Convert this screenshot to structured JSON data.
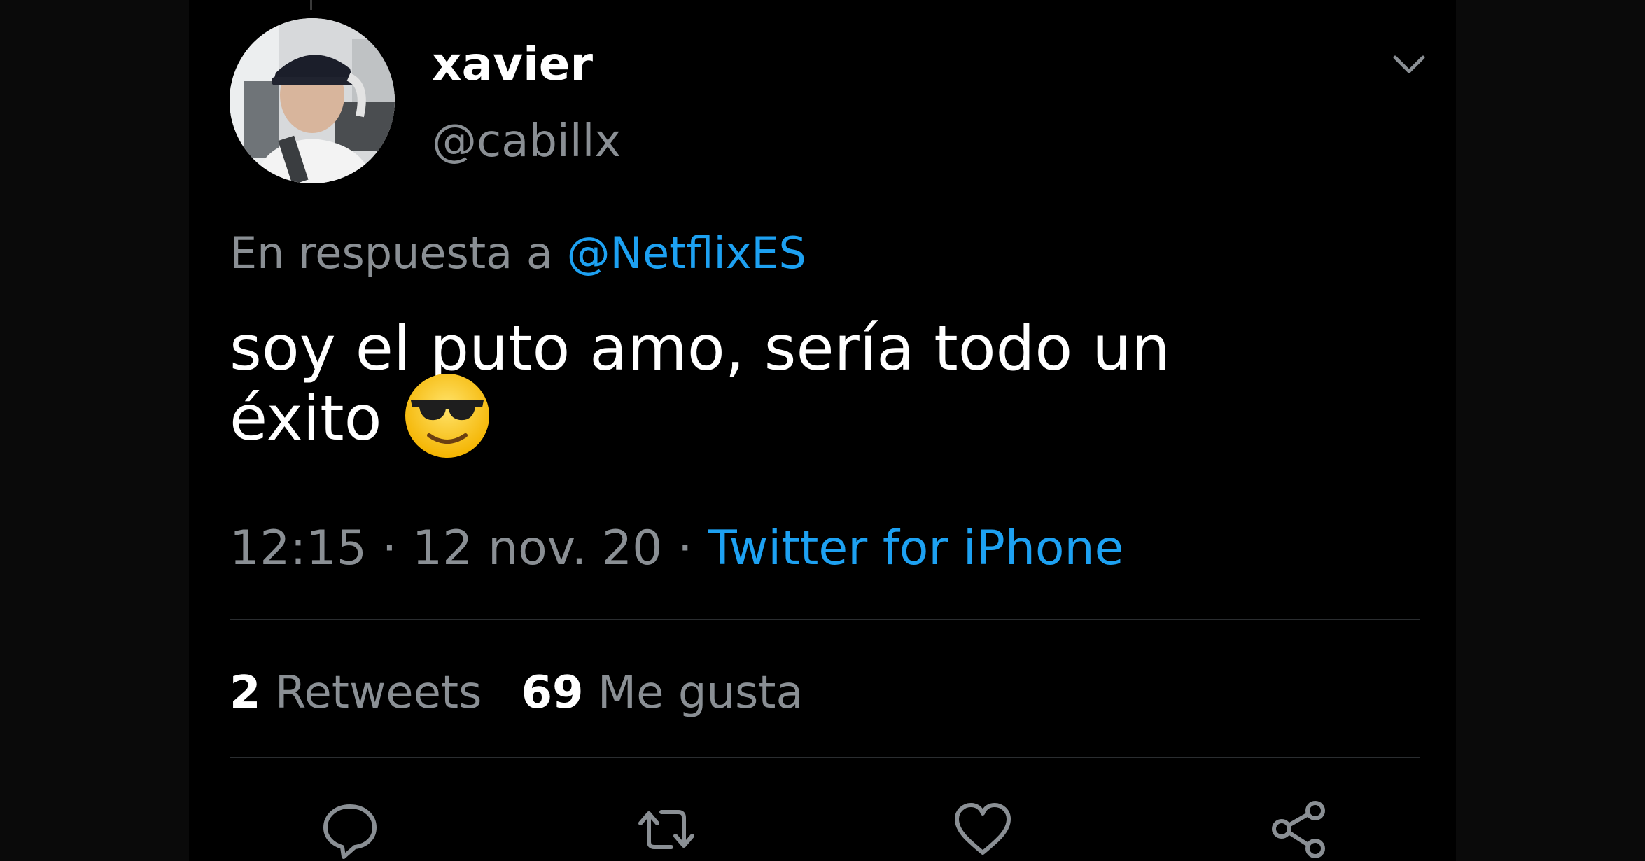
{
  "tweet": {
    "display_name": "xavier",
    "handle": "@cabillx",
    "reply_prefix": "En respuesta a",
    "reply_to": "@NetflixES",
    "text_line1": "soy el puto amo, sería todo un",
    "text_line2": "éxito",
    "emoji": "smiling-face-with-sunglasses",
    "time": "12:15",
    "date": "12 nov. 20",
    "separator": "·",
    "source": "Twitter for iPhone",
    "retweets_count": "2",
    "retweets_label": "Retweets",
    "likes_count": "69",
    "likes_label": "Me gusta"
  },
  "actions": [
    "reply-icon",
    "retweet-icon",
    "like-icon",
    "share-icon"
  ],
  "colors": {
    "background": "#000000",
    "text_primary": "#ffffff",
    "text_secondary": "#8a8f94",
    "accent": "#1da1f2",
    "divider": "#2a2d30"
  }
}
